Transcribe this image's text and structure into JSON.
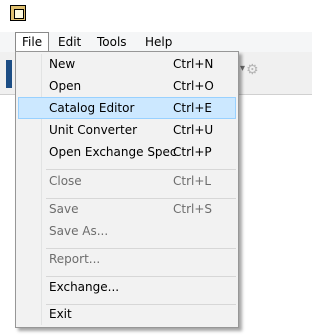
{
  "menubar": {
    "items": [
      {
        "label": "File"
      },
      {
        "label": "Edit"
      },
      {
        "label": "Tools"
      },
      {
        "label": "Help"
      }
    ]
  },
  "file_menu": {
    "items": [
      {
        "label": "New",
        "shortcut": "Ctrl+N",
        "enabled": true
      },
      {
        "label": "Open",
        "shortcut": "Ctrl+O",
        "enabled": true
      },
      {
        "label": "Catalog Editor",
        "shortcut": "Ctrl+E",
        "enabled": true,
        "highlighted": true
      },
      {
        "label": "Unit Converter",
        "shortcut": "Ctrl+U",
        "enabled": true
      },
      {
        "label": "Open Exchange Spec",
        "shortcut": "Ctrl+P",
        "enabled": true
      },
      {
        "label": "Close",
        "shortcut": "Ctrl+L",
        "enabled": false
      },
      {
        "label": "Save",
        "shortcut": "Ctrl+S",
        "enabled": false
      },
      {
        "label": "Save As...",
        "shortcut": "",
        "enabled": false
      },
      {
        "label": "Report...",
        "shortcut": "",
        "enabled": false
      },
      {
        "label": "Exchange...",
        "shortcut": "",
        "enabled": true
      },
      {
        "label": "Exit",
        "shortcut": "",
        "enabled": true
      }
    ]
  },
  "colors": {
    "menu_background": "#f2f2f2",
    "highlight_background": "#cce8ff",
    "highlight_border": "#99d1ff",
    "disabled_text": "#6d6d6d"
  },
  "icons": {
    "app": "app-icon",
    "toolbar_overflow": "chevron-down-icon",
    "toolbar_settings": "gear-icon"
  }
}
